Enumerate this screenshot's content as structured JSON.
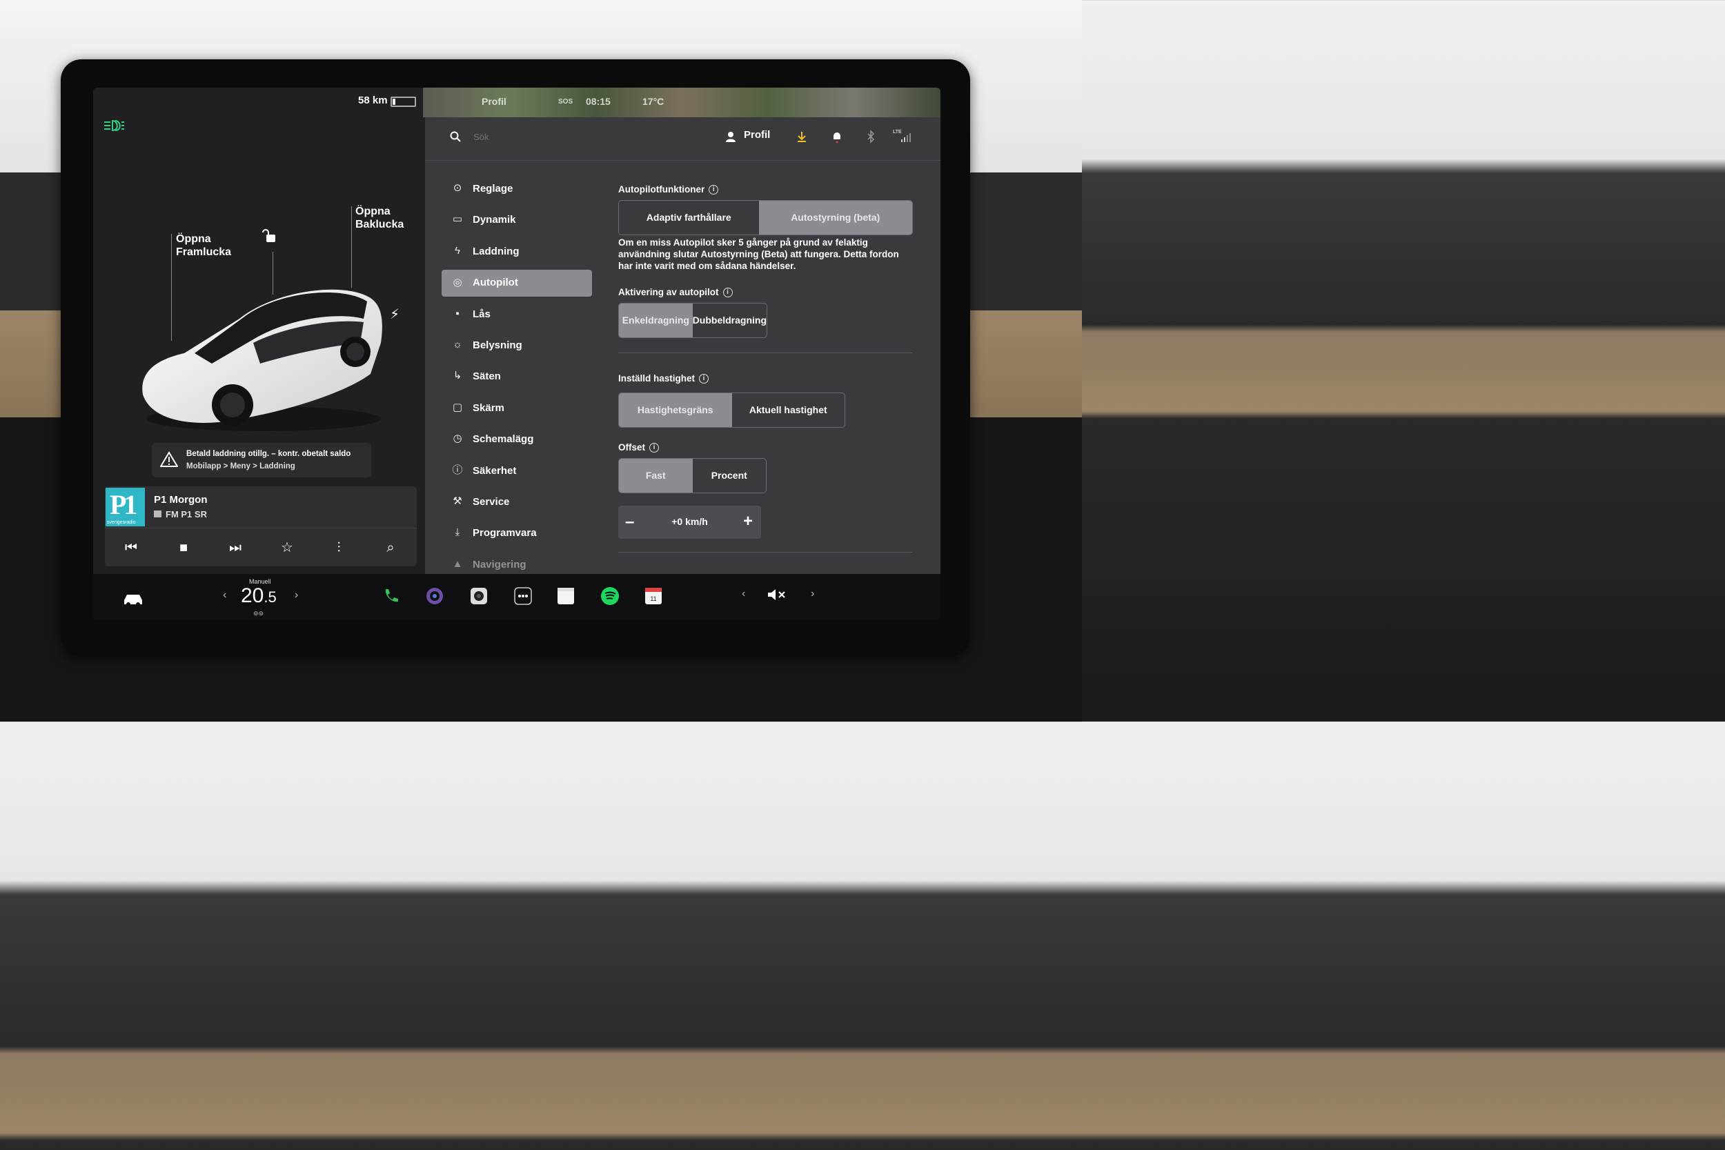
{
  "status": {
    "range": "58 km"
  },
  "left": {
    "open_frunk": {
      "line1": "Öppna",
      "line2": "Framlucka"
    },
    "open_trunk": {
      "line1": "Öppna",
      "line2": "Baklucka"
    }
  },
  "alert": {
    "title": "Betald laddning otillg. – kontr. obetalt saldo",
    "subtitle": "Mobilapp > Meny > Laddning"
  },
  "media": {
    "logo_text": "P1",
    "logo_sub": "sverigesradio",
    "title": "P1 Morgon",
    "subtitle": "FM P1 SR"
  },
  "mapstrip": {
    "profile": "Profil",
    "sos": "SOS",
    "time": "08:15",
    "temp": "17°C"
  },
  "search": {
    "placeholder": "Sök"
  },
  "toolbar": {
    "profile_label": "Profil",
    "lte": "LTE"
  },
  "nav": {
    "items": [
      {
        "label": "Reglage",
        "icon": "toggle-icon"
      },
      {
        "label": "Dynamik",
        "icon": "car-icon"
      },
      {
        "label": "Laddning",
        "icon": "bolt-icon"
      },
      {
        "label": "Autopilot",
        "icon": "steering-wheel-icon",
        "active": true
      },
      {
        "label": "Lås",
        "icon": "lock-icon"
      },
      {
        "label": "Belysning",
        "icon": "sun-icon"
      },
      {
        "label": "Säten",
        "icon": "seat-icon"
      },
      {
        "label": "Skärm",
        "icon": "display-icon"
      },
      {
        "label": "Schemalägg",
        "icon": "clock-icon"
      },
      {
        "label": "Säkerhet",
        "icon": "info-circle-icon"
      },
      {
        "label": "Service",
        "icon": "wrench-icon"
      },
      {
        "label": "Programvara",
        "icon": "download-icon"
      },
      {
        "label": "Navigering",
        "icon": "navigation-icon"
      }
    ]
  },
  "autopilot": {
    "features_heading": "Autopilotfunktioner",
    "features": {
      "opt1": "Adaptiv farthållare",
      "opt2": "Autostyrning (beta)"
    },
    "description": "Om en miss Autopilot sker 5 gånger på grund av felaktig användning slutar Autostyrning (Beta) att fungera. Detta fordon har inte varit med om sådana händelser.",
    "activation_heading": "Aktivering av autopilot",
    "activation": {
      "opt1": "Enkeldragning",
      "opt2": "Dubbeldragning"
    },
    "speed_heading": "Inställd hastighet",
    "speed": {
      "opt1": "Hastighetsgräns",
      "opt2": "Aktuell hastighet"
    },
    "offset_heading": "Offset",
    "offset": {
      "opt1": "Fast",
      "opt2": "Procent"
    },
    "offset_value": "+0 km/h",
    "minus": "–",
    "plus": "+"
  },
  "climate": {
    "mode": "Manuell",
    "temp_int": "20",
    "temp_dec": ".5"
  },
  "colors": {
    "accent": "#8c8c93",
    "panel": "#39393e",
    "headlight": "#35d07f"
  }
}
